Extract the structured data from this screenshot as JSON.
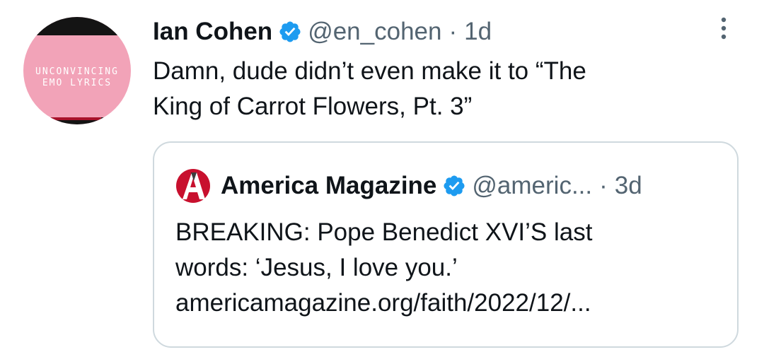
{
  "avatar": {
    "line1": "UNCONVINCING",
    "line2": "EMO LYRICS",
    "colors": {
      "background": "#f2a3b8",
      "band": "#141414",
      "accent": "#a8122a"
    }
  },
  "tweet": {
    "display_name": "Ian Cohen",
    "handle": "@en_cohen",
    "separator": "·",
    "time": "1d",
    "text_line1": "Damn, dude didn’t even make it to “The",
    "text_line2": "King of Carrot Flowers, Pt. 3”",
    "icons": {
      "verified": "verified-badge-icon",
      "more": "more-vertical-icon"
    }
  },
  "quote": {
    "display_name": "America Magazine",
    "handle": "@americ...",
    "separator": "·",
    "time": "3d",
    "text_line1": "BREAKING: Pope Benedict XVI’S last",
    "text_line2": "words: ‘Jesus, I love you.’",
    "text_line3": "americamagazine.org/faith/2022/12/...",
    "icons": {
      "logo": "america-magazine-logo-icon",
      "verified": "verified-badge-icon"
    }
  },
  "colors": {
    "text_primary": "#0f1419",
    "text_secondary": "#536471",
    "verified_blue": "#1d9bf0",
    "card_border": "#cfd9de",
    "logo_red": "#c8102e"
  }
}
